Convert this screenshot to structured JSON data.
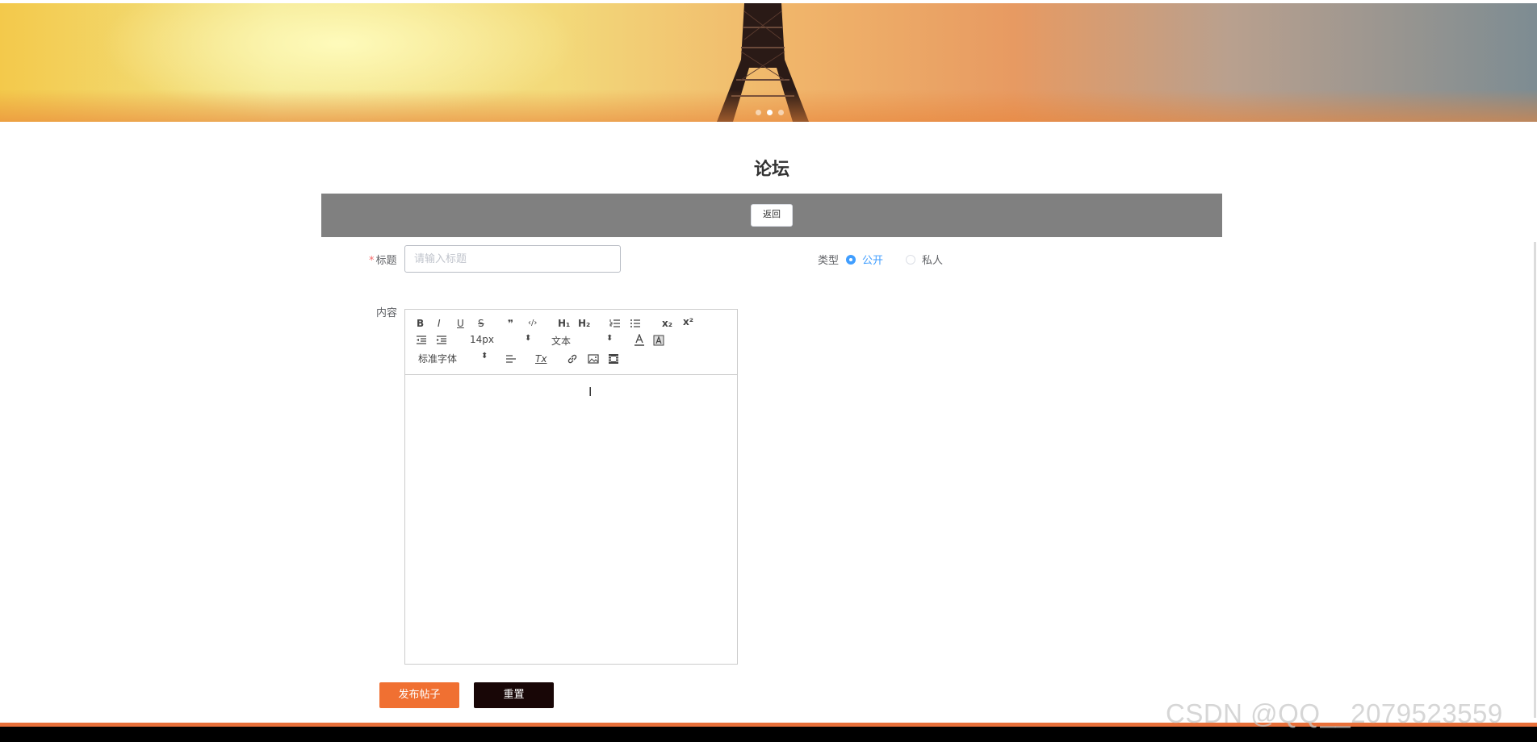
{
  "banner": {
    "slides": 3,
    "active_slide": 2
  },
  "page_title": "论坛",
  "toolbar": {
    "back_label": "返回"
  },
  "form": {
    "title_label": "标题",
    "title_required_mark": "*",
    "title_placeholder": "请输入标题",
    "type_label": "类型",
    "type_options": [
      {
        "label": "公开",
        "checked": true
      },
      {
        "label": "私人",
        "checked": false
      }
    ],
    "content_label": "内容",
    "editor": {
      "buttons": {
        "bold": "B",
        "italic": "I",
        "underline": "U",
        "strike": "S",
        "blockquote": "❞",
        "code": "‹/›",
        "h1": "H₁",
        "h2": "H₂",
        "subscript": "x₂",
        "superscript": "x²"
      },
      "size_value": "14px",
      "header_value": "文本",
      "font_value": "标准字体"
    },
    "publish_label": "发布帖子",
    "reset_label": "重置"
  },
  "watermark": "CSDN @QQ__2079523559",
  "colors": {
    "primary": "#409eff",
    "publish": "#f07032",
    "reset": "#180606",
    "bar": "#808080",
    "footer_accent": "#e8703a"
  }
}
